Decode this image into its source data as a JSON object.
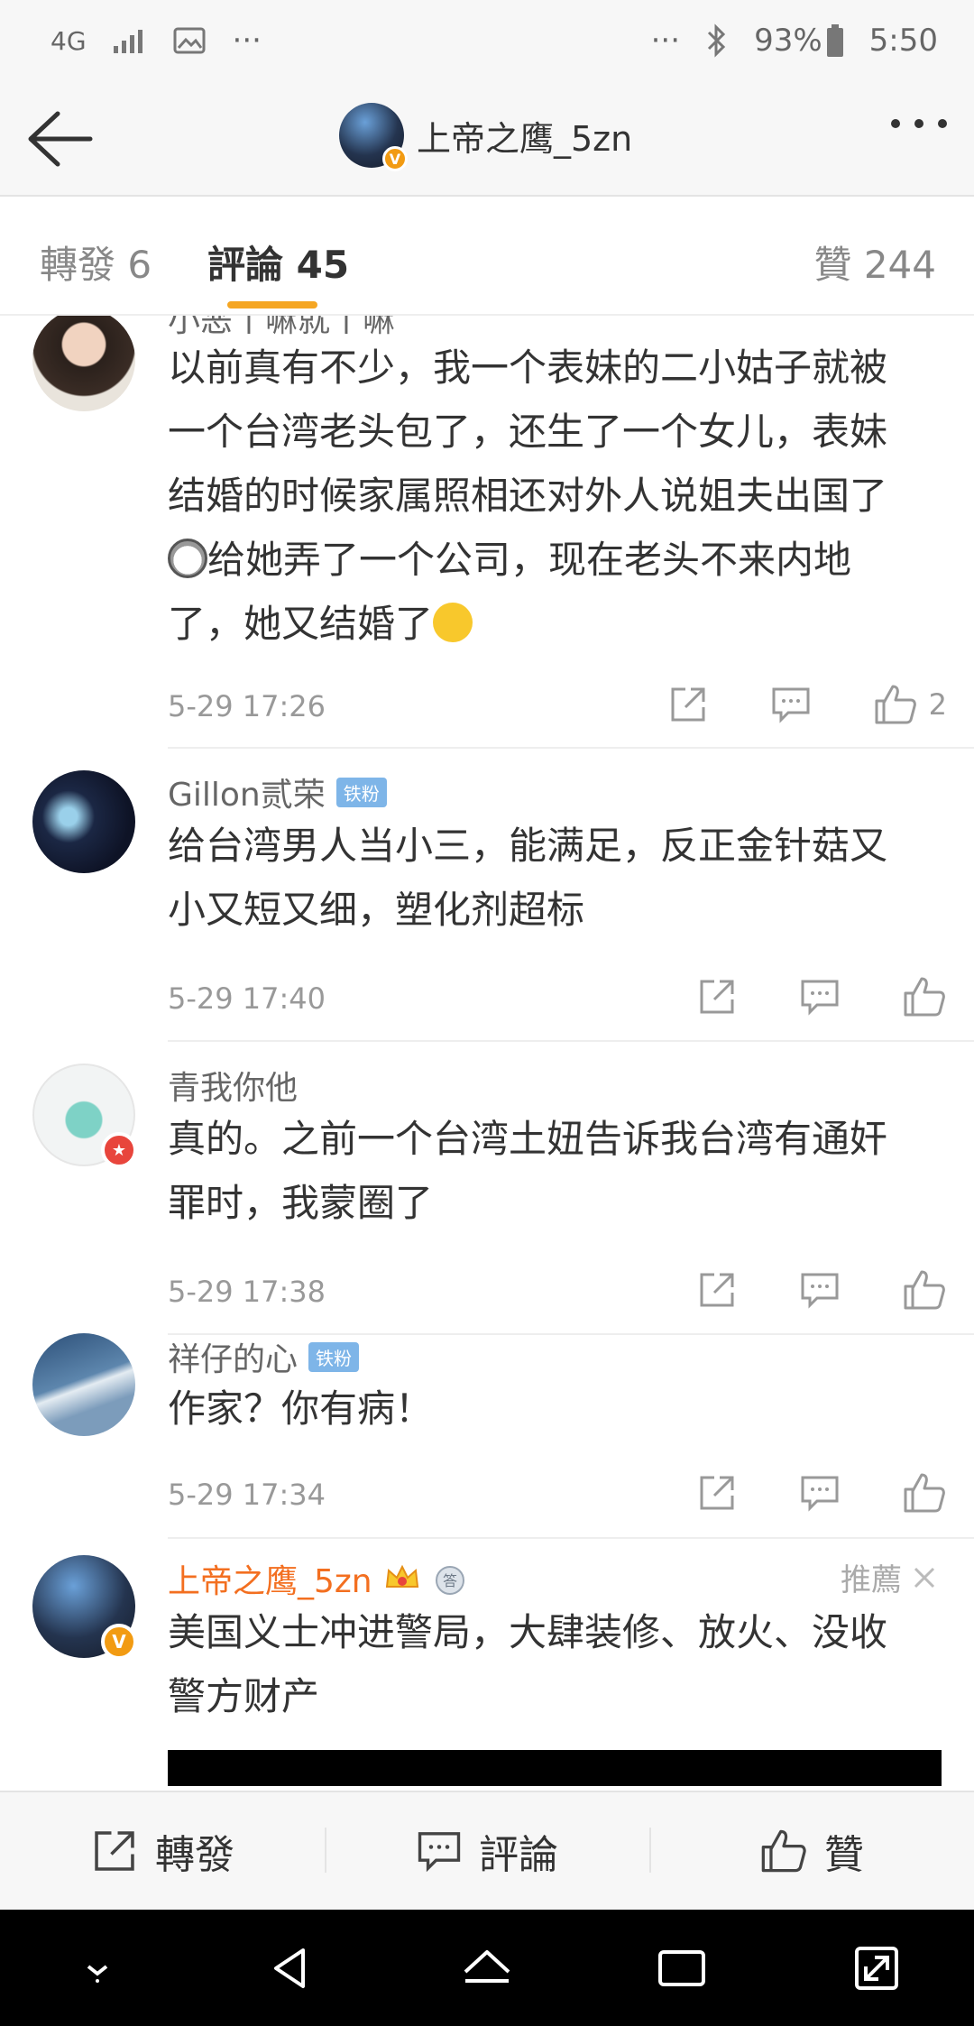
{
  "status_bar": {
    "network": "4G",
    "battery": "93%",
    "time": "5:50",
    "dots": "···"
  },
  "nav": {
    "title": "上帝之鹰_5zn",
    "avatar_badge": "V"
  },
  "tabs": {
    "forward": "轉發 6",
    "comments": "評論 45",
    "likes": "贊 244"
  },
  "comments": [
    {
      "name": "小恶丨嘛就丨嘛",
      "text_lines": [
        "以前真有不少，我一个表妹的二小姑子就被",
        "一个台湾老头包了，还生了一个女儿，表妹",
        "结婚的时候家属照相还对外人说姐夫出国了",
        "给她弄了一个公司，现在老头不来内地",
        "了，她又结婚了"
      ],
      "time": "5-29 17:26",
      "likes": "2"
    },
    {
      "name": "Gillon贰荣",
      "badge": "铁粉",
      "text_lines": [
        "给台湾男人当小三，能满足，反正金针菇又",
        "小又短又细，塑化剂超标"
      ],
      "time": "5-29 17:40"
    },
    {
      "name": "青我你他",
      "text_lines": [
        "真的。之前一个台湾土妞告诉我台湾有通奸",
        "罪时，我蒙圈了"
      ],
      "time": "5-29 17:38"
    },
    {
      "name": "祥仔的心",
      "badge": "铁粉",
      "text_lines": [
        "作家？你有病！"
      ],
      "time": "5-29 17:34"
    },
    {
      "name": "上帝之鹰_5zn",
      "recommend": "推薦",
      "medal_text": "答",
      "text_lines": [
        "美国义士冲进警局，大肆装修、放火、没收",
        "警方财产"
      ]
    }
  ],
  "bottom_bar": {
    "forward": "轉發",
    "comment": "評論",
    "like": "贊"
  },
  "colors": {
    "accent": "#f5a623",
    "name_orange": "#f36f20",
    "fan_badge": "#7eb5e8"
  }
}
